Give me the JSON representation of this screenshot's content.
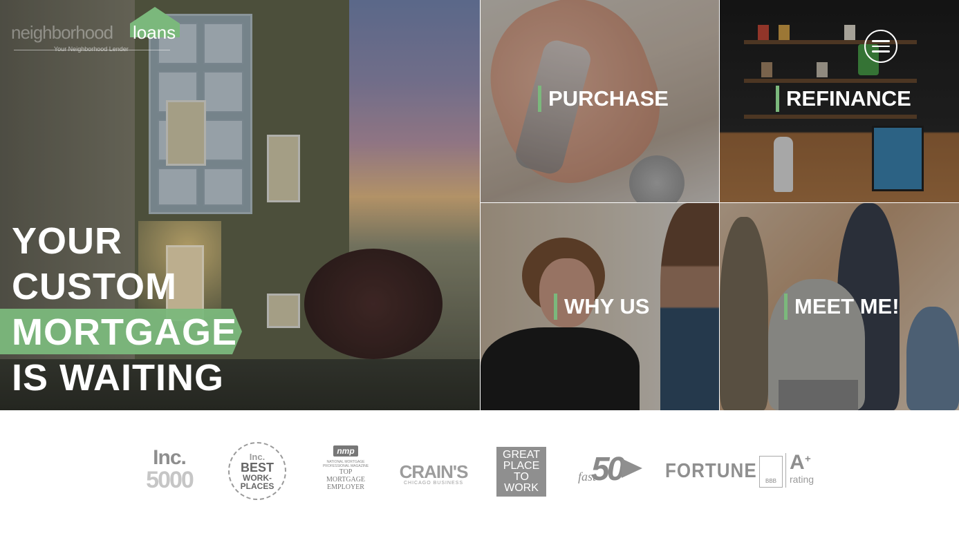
{
  "logo": {
    "name_light": "neighborhood",
    "name_bold": "loans",
    "tagline": "Your Neighborhood Lender"
  },
  "hero": {
    "lines": [
      "YOUR",
      "CUSTOM",
      "MORTGAGE",
      "IS WAITING"
    ]
  },
  "tiles": [
    {
      "label": "PURCHASE"
    },
    {
      "label": "REFINANCE"
    },
    {
      "label": "WHY US"
    },
    {
      "label": "MEET ME!"
    }
  ],
  "menu": {
    "icon": "hamburger-menu-icon"
  },
  "awards": {
    "inc5000": {
      "line1": "Inc.",
      "line2": "5000"
    },
    "inc_best": {
      "line1": "Inc.",
      "line2": "BEST",
      "line3": "WORK-",
      "line4": "PLACES"
    },
    "nmp": {
      "badge": "nmp",
      "small1": "NATIONAL MORTGAGE",
      "small2": "PROFESSIONAL MAGAZINE",
      "big1": "TOP",
      "big2": "MORTGAGE",
      "big3": "EMPLOYER"
    },
    "crains": {
      "name": "CRAIN'S",
      "sub": "CHICAGO BUSINESS"
    },
    "gptw": {
      "l1": "GREAT",
      "l2": "PLACE",
      "l3": "TO",
      "l4": "WORK"
    },
    "fast50": {
      "fast": "fast",
      "num": "50"
    },
    "fortune": {
      "name": "FORTUNE"
    },
    "bbb": {
      "seal": "BBB",
      "grade": "A",
      "plus": "+",
      "rating": "rating"
    }
  },
  "colors": {
    "accent": "#7bb87c",
    "white": "#ffffff",
    "award_gray": "#9a9a9a"
  }
}
